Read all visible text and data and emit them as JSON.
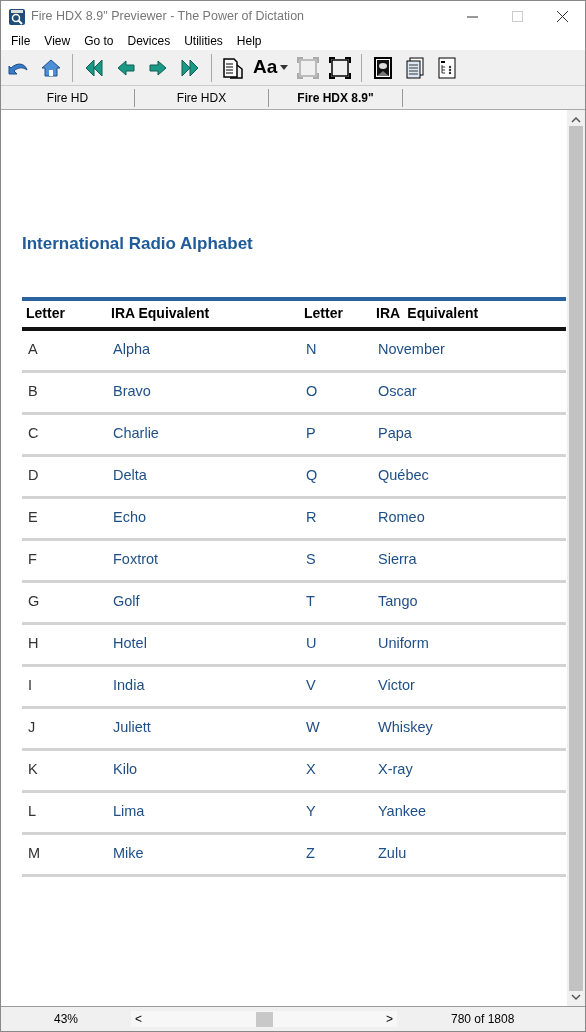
{
  "window": {
    "title": "Fire HDX 8.9\" Previewer - The Power of Dictation"
  },
  "menu": [
    {
      "label": "File"
    },
    {
      "label": "View"
    },
    {
      "label": "Go to"
    },
    {
      "label": "Devices"
    },
    {
      "label": "Utilities"
    },
    {
      "label": "Help"
    }
  ],
  "toolbar": [
    {
      "kind": "back",
      "disabled": false
    },
    {
      "kind": "home",
      "disabled": false
    },
    {
      "kind": "sep"
    },
    {
      "kind": "first",
      "disabled": false
    },
    {
      "kind": "prev",
      "disabled": false
    },
    {
      "kind": "next",
      "disabled": false
    },
    {
      "kind": "last",
      "disabled": false
    },
    {
      "kind": "sep"
    },
    {
      "kind": "toc",
      "disabled": false
    },
    {
      "kind": "font",
      "label": "Aa",
      "disabled": false
    },
    {
      "kind": "frame",
      "disabled": true
    },
    {
      "kind": "frame",
      "disabled": false
    },
    {
      "kind": "sep"
    },
    {
      "kind": "image",
      "disabled": false
    },
    {
      "kind": "pages",
      "disabled": false
    },
    {
      "kind": "list",
      "disabled": false
    }
  ],
  "tabs": [
    {
      "label": "Fire HD",
      "selected": false
    },
    {
      "label": "Fire HDX",
      "selected": false
    },
    {
      "label": "Fire HDX 8.9\"",
      "selected": true
    }
  ],
  "document": {
    "heading": "International Radio Alphabet",
    "columns": [
      "Letter",
      "IRA Equivalent",
      "Letter",
      "IRA  Equivalent"
    ],
    "rows": [
      [
        "A",
        "Alpha",
        "N",
        "November"
      ],
      [
        "B",
        "Bravo",
        "O",
        "Oscar"
      ],
      [
        "C",
        "Charlie",
        "P",
        "Papa"
      ],
      [
        "D",
        "Delta",
        "Q",
        "Québec"
      ],
      [
        "E",
        "Echo",
        "R",
        "Romeo"
      ],
      [
        "F",
        "Foxtrot",
        "S",
        "Sierra"
      ],
      [
        "G",
        "Golf",
        "T",
        "Tango"
      ],
      [
        "H",
        "Hotel",
        "U",
        "Uniform"
      ],
      [
        "I",
        "India",
        "V",
        "Victor"
      ],
      [
        "J",
        "Juliett",
        "W",
        "Whiskey"
      ],
      [
        "K",
        "Kilo",
        "X",
        "X-ray"
      ],
      [
        "L",
        "Lima",
        "Y",
        "Yankee"
      ],
      [
        "M",
        "Mike",
        "Z",
        "Zulu"
      ]
    ]
  },
  "status_bar": {
    "zoom": "43%",
    "left_arrow": "<",
    "right_arrow": ">",
    "position": "780 of 1808"
  }
}
